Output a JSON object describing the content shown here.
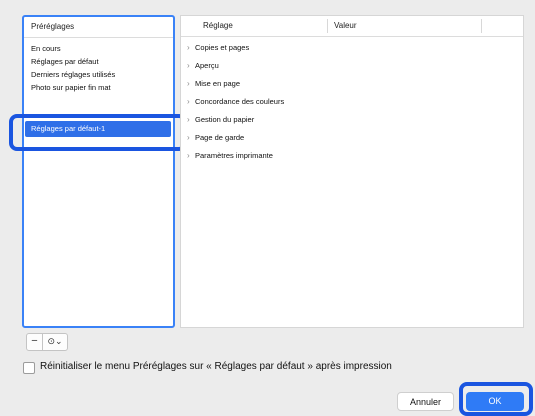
{
  "presets_panel": {
    "header": "Préréglages",
    "items": [
      {
        "label": "En cours"
      },
      {
        "label": "Réglages par défaut"
      },
      {
        "label": "Derniers réglages utilisés"
      },
      {
        "label": "Photo sur papier fin mat"
      },
      {
        "label": "Réglages par défaut-1",
        "selected": true
      }
    ]
  },
  "settings_panel": {
    "col_setting": "Réglage",
    "col_value": "Valeur",
    "rows": [
      {
        "label": "Copies et pages"
      },
      {
        "label": "Aperçu"
      },
      {
        "label": "Mise en page"
      },
      {
        "label": "Concordance des couleurs"
      },
      {
        "label": "Gestion du papier"
      },
      {
        "label": "Page de garde"
      },
      {
        "label": "Paramètres imprimante"
      }
    ]
  },
  "controls": {
    "remove_symbol": "−",
    "actions_symbol": "⊙⌄"
  },
  "reset_option": {
    "label": "Réinitialiser le menu Préréglages sur « Réglages par défaut » après impression",
    "checked": false
  },
  "buttons": {
    "cancel": "Annuler",
    "ok": "OK"
  },
  "colors": {
    "accent": "#2f7bf6",
    "selection": "#2f6fe8",
    "callout": "#1a55e0"
  }
}
